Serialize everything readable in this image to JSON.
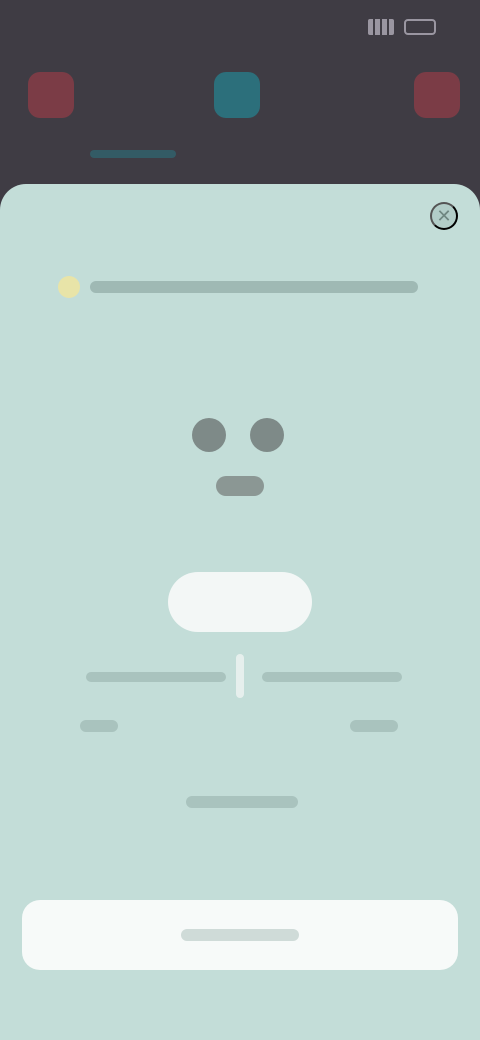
{
  "status_bar": {
    "time": "",
    "icons": [
      "signal-icon",
      "battery-icon"
    ]
  },
  "background_app": {
    "icons": [
      "app-icon",
      "app-icon",
      "app-icon"
    ]
  },
  "sheet": {
    "notice": {
      "icon": "info-dot-icon",
      "text": ""
    },
    "hero": {
      "icon": "face-icon"
    },
    "pill_button_label": "",
    "stats": [
      {
        "title": "",
        "value": ""
      },
      {
        "title": "",
        "value": ""
      }
    ],
    "hint": "",
    "primary_button_label": "",
    "colors": {
      "sheet_background": "#c3ddd8",
      "button_background": "#f7faf9",
      "overlay": "#3e3b44"
    }
  }
}
